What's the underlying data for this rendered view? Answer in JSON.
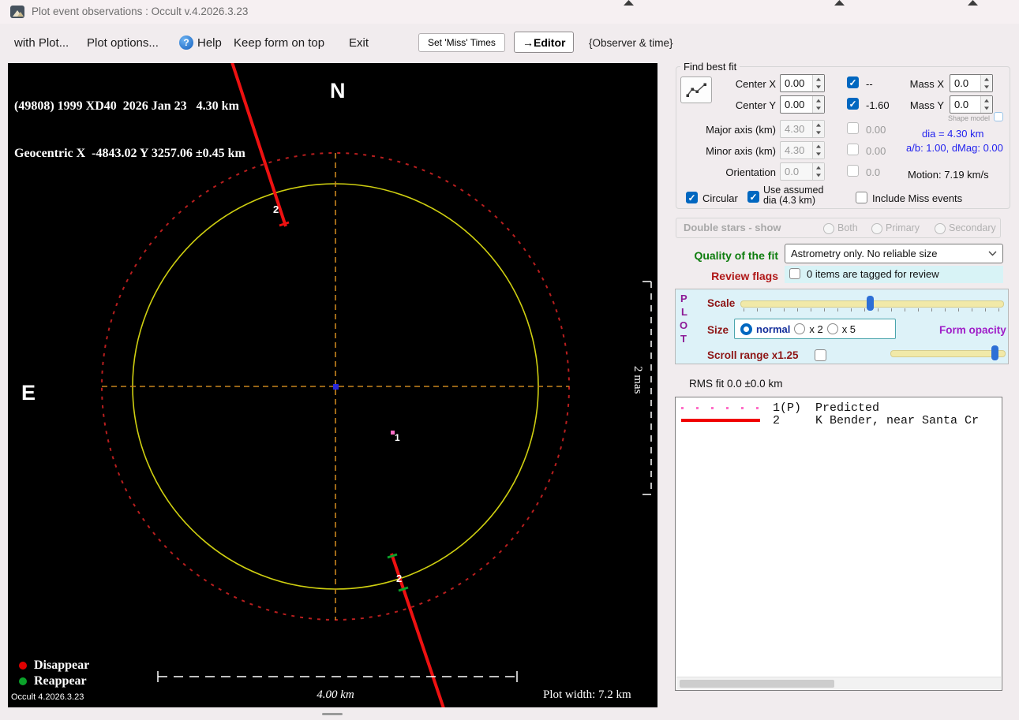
{
  "titlebar": {
    "title": "Plot event observations : Occult v.4.2026.3.23"
  },
  "menubar": {
    "with_plot": "with Plot...",
    "plot_options": "Plot options...",
    "help": "Help",
    "keep_on_top": "Keep form on top",
    "exit": "Exit",
    "set_miss_times": "Set 'Miss' Times",
    "editor": "→Editor",
    "observer_time": "{Observer & time}"
  },
  "icons": {
    "help": "?",
    "check": "✓"
  },
  "colors": {
    "accent_blue": "#0067c0",
    "plot_yellow": "#d8d800",
    "plot_red": "#ee1111",
    "crosshair_orange": "#c8851e",
    "predicted_pink": "#ff6ec7",
    "reappear_green": "#0ba22a",
    "quality_green": "#0e7d0e",
    "review_red": "#b01818",
    "plot_panel_purple": "#8c1a96",
    "info_blue": "#2222ee",
    "panel_cyan": "#ddf2f8"
  },
  "plot": {
    "header_line1": "(49808) 1999 XD40  2026 Jan 23   4.30 km",
    "header_line2": "Geocentric X  -4843.02 Y 3257.06 ±0.45 km",
    "north": "N",
    "east": "E",
    "marker_top_chord": "2",
    "marker_predicted": "1",
    "marker_bottom_chord": "2",
    "legend_disappear": "Disappear",
    "legend_reappear": "Reappear",
    "version": "Occult 4.2026.3.23",
    "scale_bar": "4.00 km",
    "plot_width": "Plot width: 7.2 km",
    "mas_scale": "2 mas"
  },
  "find_best_fit": {
    "title": "Find best fit",
    "center_x": {
      "label": "Center X",
      "value": "0.00"
    },
    "center_y": {
      "label": "Center Y",
      "value": "0.00"
    },
    "fit_x_flag": "--",
    "fit_y_flag": "-1.60",
    "mass_x": {
      "label": "Mass X",
      "value": "0.0"
    },
    "mass_y": {
      "label": "Mass Y",
      "value": "0.0"
    },
    "shape_model": "Shape model",
    "major_axis": {
      "label": "Major axis (km)",
      "value": "4.30",
      "flag": "0.00"
    },
    "minor_axis": {
      "label": "Minor axis (km)",
      "value": "4.30",
      "flag": "0.00"
    },
    "orientation": {
      "label": "Orientation",
      "value": "0.0",
      "flag": "0.0"
    },
    "dia_info": "dia = 4.30 km",
    "ab_info": "a/b: 1.00, dMag: 0.00",
    "motion_info": "Motion: 7.19 km/s",
    "circular": "Circular",
    "use_assumed": "Use assumed dia (4.3 km)",
    "include_miss": "Include Miss events"
  },
  "double_stars": {
    "title": "Double stars - show",
    "both": "Both",
    "primary": "Primary",
    "secondary": "Secondary"
  },
  "quality_of_fit": {
    "label": "Quality of the fit",
    "value": "Astrometry only. No reliable size"
  },
  "review_flags": {
    "label": "Review flags",
    "value": "0 items are tagged for review"
  },
  "plot_controls": {
    "p": "P",
    "l": "L",
    "o": "O",
    "t": "T",
    "scale": "Scale",
    "size": "Size",
    "size_normal": "normal",
    "size_x2": "x 2",
    "size_x5": "x 5",
    "form_opacity": "Form opacity",
    "scroll_range": "Scroll range x1.25"
  },
  "rms_fit": "RMS fit 0.0 ±0.0 km",
  "observations": [
    {
      "id": "1(P)",
      "style": "dotted-pink",
      "text": "1(P)  Predicted"
    },
    {
      "id": "2",
      "style": "solid-red",
      "text": "2     K Bender, near Santa Cr"
    }
  ]
}
